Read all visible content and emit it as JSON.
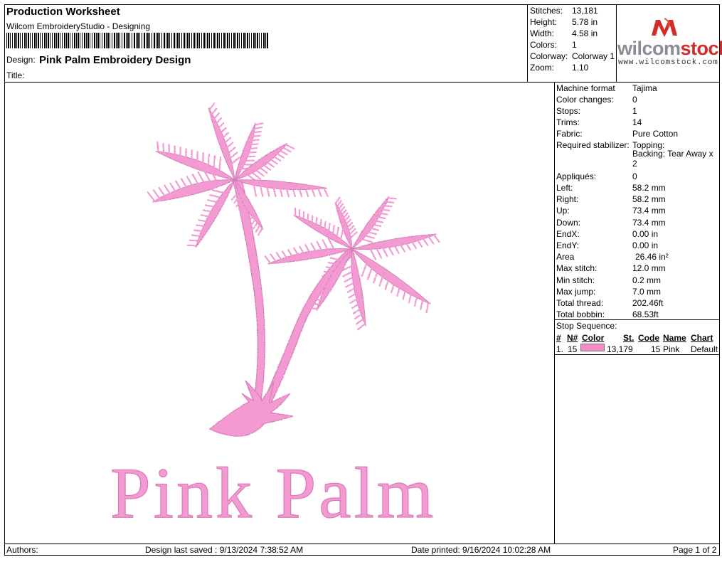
{
  "header": {
    "title": "Production Worksheet",
    "subtitle": "Wilcom EmbroideryStudio - Designing",
    "design_label": "Design:",
    "design_name": "Pink Palm Embroidery Design",
    "title_label": "Title:"
  },
  "summary": [
    {
      "label": "Stitches:",
      "value": "13,181"
    },
    {
      "label": "Height:",
      "value": "5.78 in"
    },
    {
      "label": "Width:",
      "value": "4.58 in"
    },
    {
      "label": "Colors:",
      "value": "1"
    },
    {
      "label": "Colorway:",
      "value": "Colorway 1"
    },
    {
      "label": "Zoom:",
      "value": "1.10"
    }
  ],
  "logo": {
    "brand_wilcom": "wilcom",
    "brand_stock": "stock",
    "url": "www.wilcomstock.com",
    "colors": {
      "wilcom": "#8a8d93",
      "stock": "#d42a2a"
    }
  },
  "details": [
    {
      "label": "Machine format",
      "value": "Tajima"
    },
    {
      "label": "Color changes:",
      "value": "0"
    },
    {
      "label": "Stops:",
      "value": "1"
    },
    {
      "label": "Trims:",
      "value": "14"
    },
    {
      "label": "Fabric:",
      "value": "Pure Cotton"
    },
    {
      "label": "Required stabilizer:",
      "value": "Topping:"
    },
    {
      "label": "",
      "value": "Backing: Tear Away x"
    },
    {
      "label": "",
      "value": "2"
    },
    {
      "label": "Appliqués:",
      "value": "0"
    },
    {
      "label": "Left:",
      "value": "58.2 mm"
    },
    {
      "label": "Right:",
      "value": "58.2 mm"
    },
    {
      "label": "Up:",
      "value": "73.4 mm"
    },
    {
      "label": "Down:",
      "value": "73.4 mm"
    },
    {
      "label": "EndX:",
      "value": "0.00 in"
    },
    {
      "label": "EndY:",
      "value": "0.00 in"
    },
    {
      "label": "Area",
      "value": "26.46 in²"
    },
    {
      "label": "Max stitch:",
      "value": "12.0 mm"
    },
    {
      "label": "Min stitch:",
      "value": "0.2 mm"
    },
    {
      "label": "Max jump:",
      "value": "7.0 mm"
    },
    {
      "label": "Total thread:",
      "value": "202.46ft"
    },
    {
      "label": "Total bobbin:",
      "value": "68.53ft"
    }
  ],
  "stop_sequence": {
    "title": "Stop Sequence:",
    "headers": {
      "num": "#",
      "n": "N#",
      "color": "Color",
      "st": "St.",
      "code": "Code",
      "name": "Name",
      "chart": "Chart"
    },
    "rows": [
      {
        "num": "1.",
        "n": "15",
        "color_hex": "#f58ac6",
        "st": "13,179",
        "code": "15",
        "name": "Pink",
        "chart": "Default"
      }
    ]
  },
  "design": {
    "text": "Pink Palm",
    "thread_color": "#f39ad2"
  },
  "footer": {
    "authors": "Authors:",
    "saved": "Design last saved : 9/13/2024 7:38:52 AM",
    "printed": "Date printed: 9/16/2024 10:02:28 AM",
    "page": "Page 1 of 2"
  }
}
